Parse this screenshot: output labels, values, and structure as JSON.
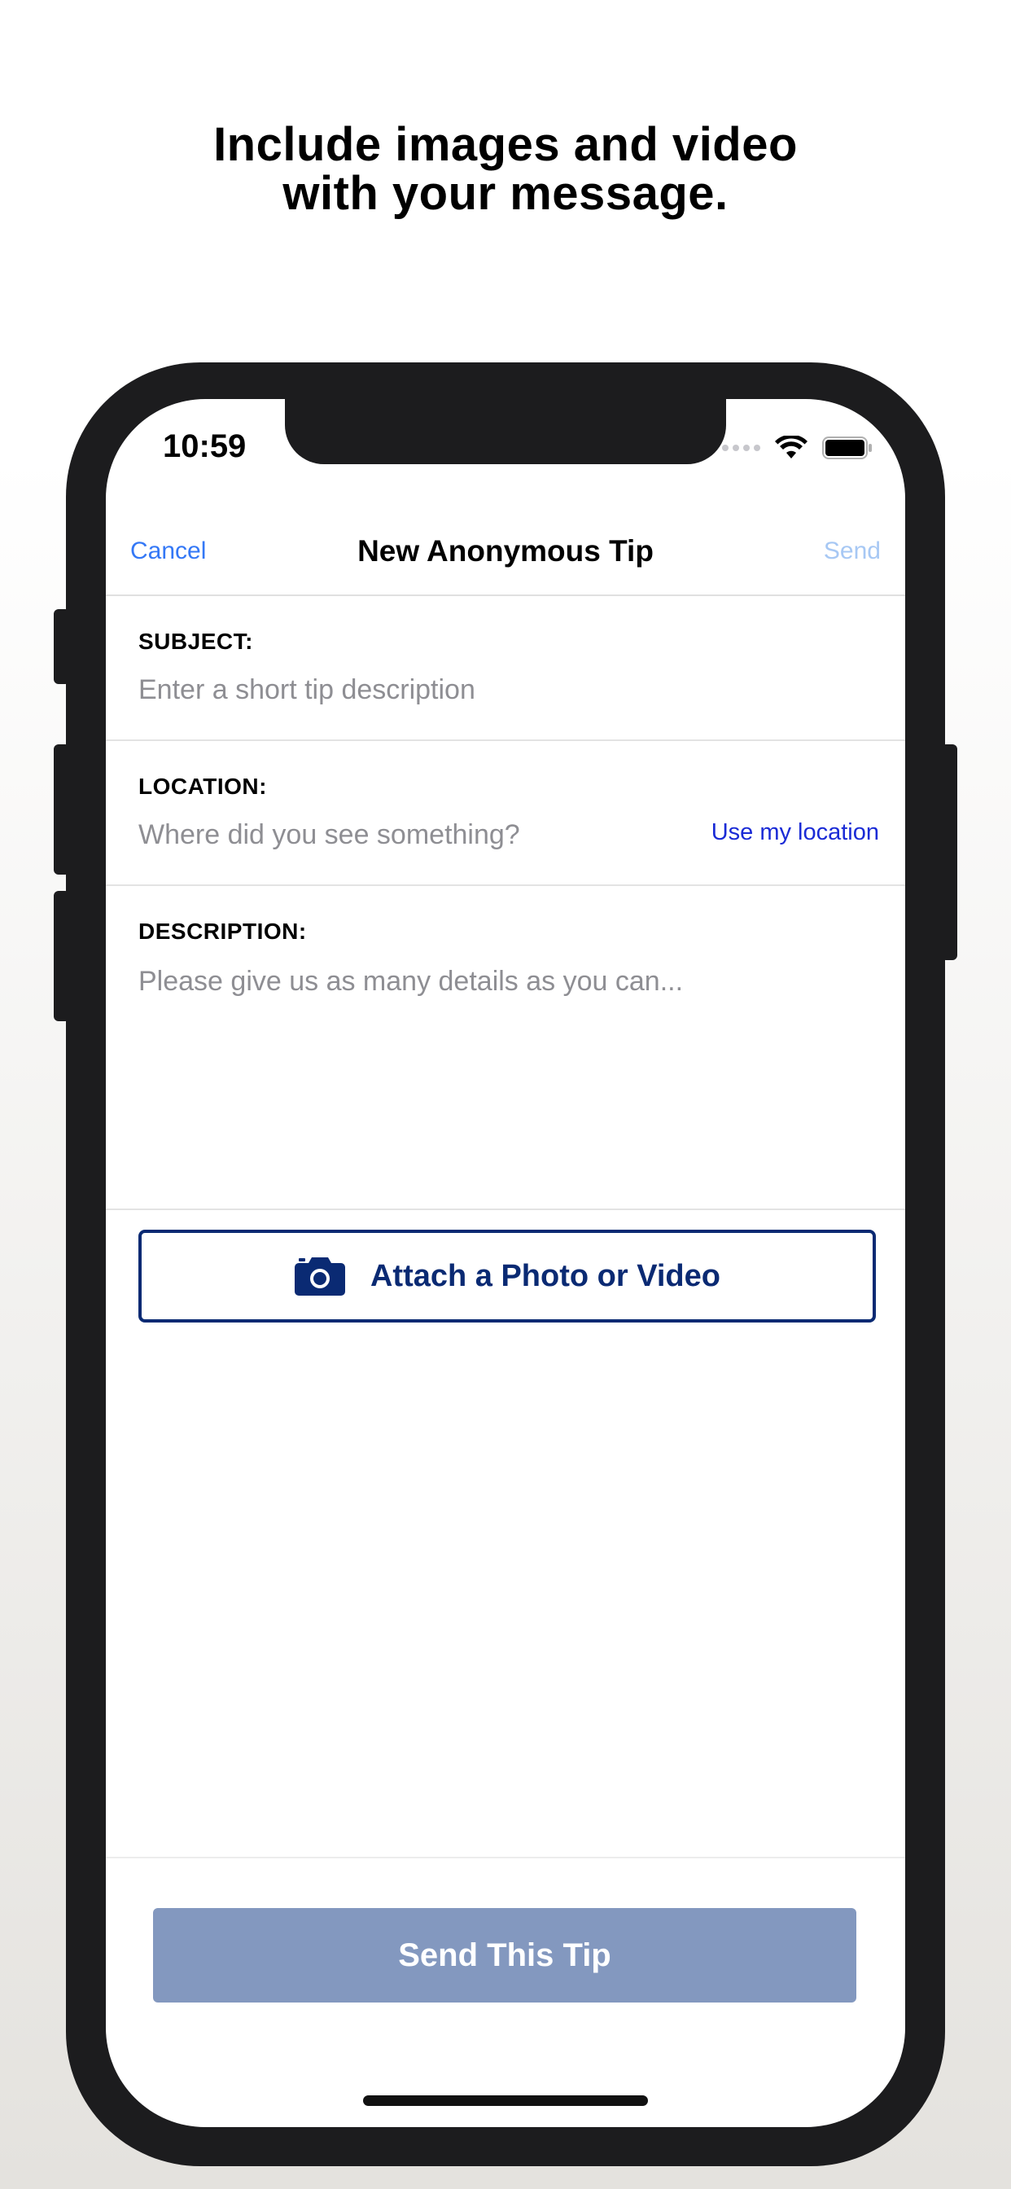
{
  "headline": {
    "line1": "Include images and video",
    "line2": "with your message."
  },
  "status_bar": {
    "time": "10:59",
    "icons": [
      "cellular-signal-icon",
      "wifi-icon",
      "battery-icon"
    ]
  },
  "nav": {
    "cancel_label": "Cancel",
    "title": "New Anonymous Tip",
    "send_label": "Send"
  },
  "form": {
    "subject": {
      "label": "SUBJECT:",
      "placeholder": "Enter a short tip description",
      "value": ""
    },
    "location": {
      "label": "LOCATION:",
      "placeholder": "Where did you see something?",
      "value": "",
      "use_location_label": "Use my location"
    },
    "description": {
      "label": "DESCRIPTION:",
      "placeholder": "Please give us as many details as you can...",
      "value": ""
    }
  },
  "attach_button": {
    "label": "Attach a Photo or Video",
    "icon": "camera-icon"
  },
  "send_tip_button": {
    "label": "Send This Tip"
  },
  "colors": {
    "ios_blue": "#3478f6",
    "ios_blue_disabled": "#a7c8f4",
    "navy": "#0a2a73",
    "link_blue": "#1a2bd6",
    "send_button_disabled": "#8398bf",
    "placeholder_gray": "#8e8e93"
  }
}
